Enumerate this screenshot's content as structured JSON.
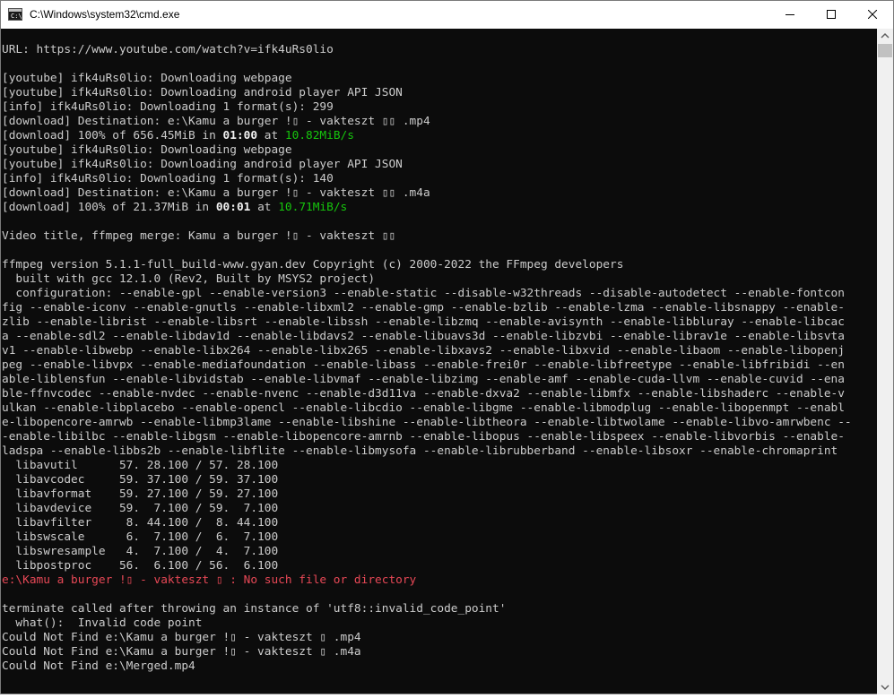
{
  "window": {
    "title": "C:\\Windows\\system32\\cmd.exe",
    "icon_label": "C:\\"
  },
  "console": {
    "lines": [
      [
        {
          "t": ""
        }
      ],
      [
        {
          "t": "URL: https://www.youtube.com/watch?v=ifk4uRs0lio"
        }
      ],
      [
        {
          "t": ""
        }
      ],
      [
        {
          "t": "[youtube] ifk4uRs0lio: Downloading webpage"
        }
      ],
      [
        {
          "t": "[youtube] ifk4uRs0lio: Downloading android player API JSON"
        }
      ],
      [
        {
          "t": "[info] ifk4uRs0lio: Downloading 1 format(s): 299"
        }
      ],
      [
        {
          "t": "[download] Destination: e:\\Kamu a burger !▯ - vakteszt ▯▯ .mp4"
        }
      ],
      [
        {
          "t": "[download] 100% of 656.45MiB in "
        },
        {
          "t": "01:00",
          "c": "b"
        },
        {
          "t": " at "
        },
        {
          "t": "10.82MiB/s",
          "c": "g"
        }
      ],
      [
        {
          "t": "[youtube] ifk4uRs0lio: Downloading webpage"
        }
      ],
      [
        {
          "t": "[youtube] ifk4uRs0lio: Downloading android player API JSON"
        }
      ],
      [
        {
          "t": "[info] ifk4uRs0lio: Downloading 1 format(s): 140"
        }
      ],
      [
        {
          "t": "[download] Destination: e:\\Kamu a burger !▯ - vakteszt ▯▯ .m4a"
        }
      ],
      [
        {
          "t": "[download] 100% of 21.37MiB in "
        },
        {
          "t": "00:01",
          "c": "b"
        },
        {
          "t": " at "
        },
        {
          "t": "10.71MiB/s",
          "c": "g"
        }
      ],
      [
        {
          "t": ""
        }
      ],
      [
        {
          "t": "Video title, ffmpeg merge: Kamu a burger !▯ - vakteszt ▯▯"
        }
      ],
      [
        {
          "t": ""
        }
      ],
      [
        {
          "t": "ffmpeg version 5.1.1-full_build-www.gyan.dev Copyright (c) 2000-2022 the FFmpeg developers"
        }
      ],
      [
        {
          "t": "  built with gcc 12.1.0 (Rev2, Built by MSYS2 project)"
        }
      ],
      [
        {
          "t": "  configuration: --enable-gpl --enable-version3 --enable-static --disable-w32threads --disable-autodetect --enable-fontcon"
        }
      ],
      [
        {
          "t": "fig --enable-iconv --enable-gnutls --enable-libxml2 --enable-gmp --enable-bzlib --enable-lzma --enable-libsnappy --enable-"
        }
      ],
      [
        {
          "t": "zlib --enable-librist --enable-libsrt --enable-libssh --enable-libzmq --enable-avisynth --enable-libbluray --enable-libcac"
        }
      ],
      [
        {
          "t": "a --enable-sdl2 --enable-libdav1d --enable-libdavs2 --enable-libuavs3d --enable-libzvbi --enable-librav1e --enable-libsvta"
        }
      ],
      [
        {
          "t": "v1 --enable-libwebp --enable-libx264 --enable-libx265 --enable-libxavs2 --enable-libxvid --enable-libaom --enable-libopenj"
        }
      ],
      [
        {
          "t": "peg --enable-libvpx --enable-mediafoundation --enable-libass --enable-frei0r --enable-libfreetype --enable-libfribidi --en"
        }
      ],
      [
        {
          "t": "able-liblensfun --enable-libvidstab --enable-libvmaf --enable-libzimg --enable-amf --enable-cuda-llvm --enable-cuvid --ena"
        }
      ],
      [
        {
          "t": "ble-ffnvcodec --enable-nvdec --enable-nvenc --enable-d3d11va --enable-dxva2 --enable-libmfx --enable-libshaderc --enable-v"
        }
      ],
      [
        {
          "t": "ulkan --enable-libplacebo --enable-opencl --enable-libcdio --enable-libgme --enable-libmodplug --enable-libopenmpt --enabl"
        }
      ],
      [
        {
          "t": "e-libopencore-amrwb --enable-libmp3lame --enable-libshine --enable-libtheora --enable-libtwolame --enable-libvo-amrwbenc --"
        }
      ],
      [
        {
          "t": "-enable-libilbc --enable-libgsm --enable-libopencore-amrnb --enable-libopus --enable-libspeex --enable-libvorbis --enable-"
        }
      ],
      [
        {
          "t": "ladspa --enable-libbs2b --enable-libflite --enable-libmysofa --enable-librubberband --enable-libsoxr --enable-chromaprint"
        }
      ],
      [
        {
          "t": "  libavutil      57. 28.100 / 57. 28.100"
        }
      ],
      [
        {
          "t": "  libavcodec     59. 37.100 / 59. 37.100"
        }
      ],
      [
        {
          "t": "  libavformat    59. 27.100 / 59. 27.100"
        }
      ],
      [
        {
          "t": "  libavdevice    59.  7.100 / 59.  7.100"
        }
      ],
      [
        {
          "t": "  libavfilter     8. 44.100 /  8. 44.100"
        }
      ],
      [
        {
          "t": "  libswscale      6.  7.100 /  6.  7.100"
        }
      ],
      [
        {
          "t": "  libswresample   4.  7.100 /  4.  7.100"
        }
      ],
      [
        {
          "t": "  libpostproc    56.  6.100 / 56.  6.100"
        }
      ],
      [
        {
          "t": "e:\\Kamu a burger !▯ - vakteszt ▯ : No such file or directory",
          "c": "red"
        }
      ],
      [
        {
          "t": ""
        }
      ],
      [
        {
          "t": "terminate called after throwing an instance of 'utf8::invalid_code_point'"
        }
      ],
      [
        {
          "t": "  what():  Invalid code point"
        }
      ],
      [
        {
          "t": "Could Not Find e:\\Kamu a burger !▯ - vakteszt ▯ .mp4"
        }
      ],
      [
        {
          "t": "Could Not Find e:\\Kamu a burger !▯ - vakteszt ▯ .m4a"
        }
      ],
      [
        {
          "t": "Could Not Find e:\\Merged.mp4"
        }
      ]
    ]
  },
  "colors": {
    "console_bg": "#0c0c0c",
    "console_text": "#cccccc",
    "speed_green": "#16c60c",
    "error_red": "#e74856"
  },
  "icons": [
    "cmd-app-icon",
    "minimize-icon",
    "maximize-icon",
    "close-icon",
    "scroll-up-arrow-icon",
    "scroll-down-arrow-icon"
  ]
}
